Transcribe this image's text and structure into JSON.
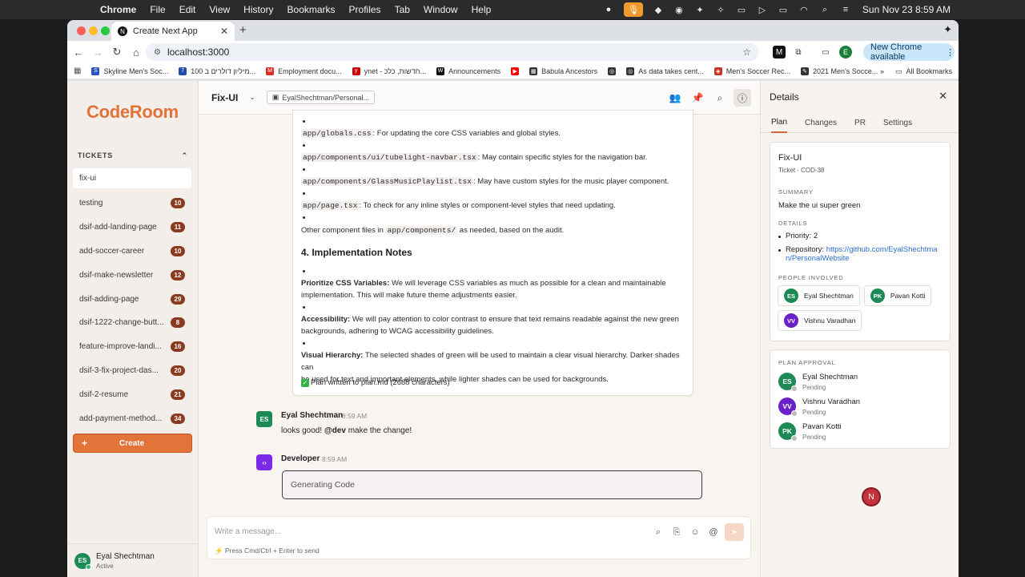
{
  "menubar": {
    "app": "Chrome",
    "items": [
      "File",
      "Edit",
      "View",
      "History",
      "Bookmarks",
      "Profiles",
      "Tab",
      "Window",
      "Help"
    ],
    "clock": "Sun Nov 23  8:59 AM"
  },
  "browser": {
    "tab_title": "Create Next App",
    "url": "localhost:3000",
    "update_label": "New Chrome available",
    "profile_initial": "E",
    "bookmarks": [
      {
        "label": "Skyline Men's Soc...",
        "color": "#2a52be",
        "icon": "S"
      },
      {
        "label": "100 מיליון דולרים ב...",
        "color": "#1f4fa8",
        "icon": "7"
      },
      {
        "label": "Employment docu...",
        "color": "#d93025",
        "icon": "M"
      },
      {
        "label": "ynet - חדשות, כלכ...",
        "color": "#cc0000",
        "icon": "y"
      },
      {
        "label": "Announcements",
        "color": "#111111",
        "icon": "W"
      },
      {
        "label": "",
        "color": "#ff0000",
        "icon": "▶"
      },
      {
        "label": "Babula Ancestors",
        "color": "#333333",
        "icon": "▦"
      },
      {
        "label": "",
        "color": "#333333",
        "icon": "◎"
      },
      {
        "label": "As data takes cent...",
        "color": "#333333",
        "icon": "◎"
      },
      {
        "label": "Men's Soccer Rec...",
        "color": "#c0392b",
        "icon": "◈"
      },
      {
        "label": "2021 Men's Socce...",
        "color": "#333333",
        "icon": "✎"
      }
    ],
    "all_bookmarks": "All Bookmarks"
  },
  "sidebar": {
    "logo": "CodeRoom",
    "section": "TICKETS",
    "active_ticket": "fix-ui",
    "tickets": [
      {
        "name": "testing",
        "count": "10"
      },
      {
        "name": "dsif-add-landing-page",
        "count": "11"
      },
      {
        "name": "add-soccer-career",
        "count": "10"
      },
      {
        "name": "dsif-make-newsletter",
        "count": "12"
      },
      {
        "name": "dsif-adding-page",
        "count": "29"
      },
      {
        "name": "dsif-1222-change-butt...",
        "count": "8"
      },
      {
        "name": "feature-improve-landi...",
        "count": "16"
      },
      {
        "name": "dsif-3-fix-project-das...",
        "count": "20"
      },
      {
        "name": "dsif-2-resume",
        "count": "21"
      },
      {
        "name": "add-payment-method...",
        "count": "34"
      }
    ],
    "create_label": "Create",
    "user": {
      "initials": "ES",
      "name": "Eyal Shechtman",
      "status": "Active"
    }
  },
  "chat": {
    "title": "Fix-UI",
    "repo": "EyalShechtman/Personal...",
    "plan": {
      "files": [
        {
          "code": "app/globals.css",
          "text": ": For updating the core CSS variables and global styles."
        },
        {
          "code": "app/components/ui/tubelight-navbar.tsx",
          "text": ": May contain specific styles for the navigation bar."
        },
        {
          "code": "app/components/GlassMusicPlaylist.tsx",
          "text": ": May have custom styles for the music player component."
        },
        {
          "code": "app/page.tsx",
          "text": ": To check for any inline styles or component-level styles that need updating."
        }
      ],
      "other_pre": "Other component files in",
      "other_code": "app/components/",
      "other_post": "as needed, based on the audit.",
      "heading": "4. Implementation Notes",
      "notes": [
        {
          "bold": "Prioritize CSS Variables:",
          "text": " We will leverage CSS variables as much as possible for a clean and maintainable",
          "text2": "implementation. This will make future theme adjustments easier."
        },
        {
          "bold": "Accessibility:",
          "text": " We will pay attention to color contrast to ensure that text remains readable against the new green",
          "text2": "backgrounds, adhering to WCAG accessibility guidelines."
        },
        {
          "bold": "Visual Hierarchy:",
          "text": " The selected shades of green will be used to maintain a clear visual hierarchy. Darker shades can",
          "text2": "be used for text and important elements, while lighter shades can be used for backgrounds."
        }
      ],
      "written": "Plan written to plan.md (2688 characters)"
    },
    "messages": [
      {
        "initials": "ES",
        "name": "Eyal Shechtman",
        "time": "8:59 AM",
        "pre": "looks good! ",
        "mention": "@dev",
        "post": " make the change!"
      },
      {
        "name": "Developer",
        "time": "8:59 AM",
        "status": "Generating Code"
      }
    ],
    "composer_placeholder": "Write a message...",
    "composer_hint": "Press Cmd/Ctrl + Enter to send"
  },
  "details": {
    "title": "Details",
    "tabs": [
      "Plan",
      "Changes",
      "PR",
      "Settings"
    ],
    "ticket_title": "Fix-UI",
    "ticket_sub": "Ticket · COD-38",
    "summary_label": "SUMMARY",
    "summary": "Make the ui super green",
    "details_label": "DETAILS",
    "priority": "Priority: 2",
    "repo_label": "Repository: ",
    "repo_url_1": "https://github.com/EyalShechtma",
    "repo_url_2": "n/PersonalWebsite",
    "people_label": "PEOPLE INVOLVED",
    "people": [
      {
        "initials": "ES",
        "name": "Eyal Shechtman",
        "color": "#1d8a55"
      },
      {
        "initials": "PK",
        "name": "Pavan Kotti",
        "color": "#1d8a55"
      },
      {
        "initials": "VV",
        "name": "Vishnu Varadhan",
        "color": "#6b21c8"
      }
    ],
    "approval_label": "PLAN APPROVAL",
    "approvals": [
      {
        "initials": "ES",
        "name": "Eyal Shechtman",
        "status": "Pending",
        "color": "#1d8a55"
      },
      {
        "initials": "VV",
        "name": "Vishnu Varadhan",
        "status": "Pending",
        "color": "#6b21c8"
      },
      {
        "initials": "PK",
        "name": "Pavan Kotti",
        "status": "Pending",
        "color": "#1d8a55"
      }
    ]
  },
  "floating_badge": "N"
}
